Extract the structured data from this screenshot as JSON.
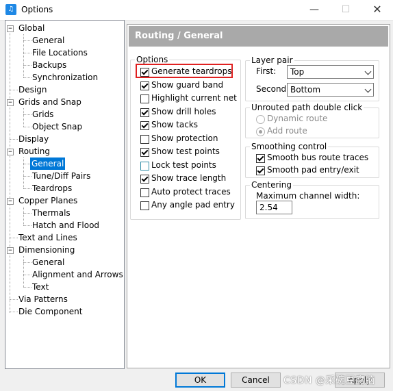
{
  "window": {
    "title": "Options",
    "app_icon_glyph": "♫",
    "minimize_glyph": "—",
    "maximize_glyph": "☐",
    "close_glyph": "✕"
  },
  "tree": {
    "expander_minus": "−",
    "global": "Global",
    "general": "General",
    "file_locations": "File Locations",
    "backups": "Backups",
    "synchronization": "Synchronization",
    "design": "Design",
    "grids_and_snap": "Grids and Snap",
    "grids": "Grids",
    "object_snap": "Object Snap",
    "display": "Display",
    "routing": "Routing",
    "routing_general": "General",
    "tune_diff_pairs": "Tune/Diff Pairs",
    "teardrops": "Teardrops",
    "copper_planes": "Copper Planes",
    "thermals": "Thermals",
    "hatch_and_flood": "Hatch and Flood",
    "text_and_lines": "Text and Lines",
    "dimensioning": "Dimensioning",
    "dim_general": "General",
    "alignment_and_arrows": "Alignment and Arrows",
    "text": "Text",
    "via_patterns": "Via Patterns",
    "die_component": "Die Component"
  },
  "panel": {
    "header": "Routing / General"
  },
  "options": {
    "title": "Options",
    "items": [
      {
        "label": "Generate teardrops",
        "checked": true
      },
      {
        "label": "Show guard band",
        "checked": true
      },
      {
        "label": "Highlight current net",
        "checked": false
      },
      {
        "label": "Show drill holes",
        "checked": true
      },
      {
        "label": "Show tacks",
        "checked": true
      },
      {
        "label": "Show protection",
        "checked": false
      },
      {
        "label": "Show test points",
        "checked": true
      },
      {
        "label": "Lock test points",
        "checked": false
      },
      {
        "label": "Show trace length",
        "checked": true
      },
      {
        "label": "Auto protect traces",
        "checked": false
      },
      {
        "label": "Any angle pad entry",
        "checked": false
      }
    ]
  },
  "layer_pair": {
    "title": "Layer pair",
    "first_label": "First:",
    "first_value": "Top",
    "second_label": "Second:",
    "second_value": "Bottom"
  },
  "unrouted": {
    "title": "Unrouted path double click",
    "opt1": "Dynamic route",
    "opt2": "Add route",
    "selected": "Add route"
  },
  "smoothing": {
    "title": "Smoothing control",
    "opt1": "Smooth bus route traces",
    "opt2": "Smooth pad entry/exit"
  },
  "centering": {
    "title": "Centering",
    "max_label": "Maximum channel width:",
    "max_value": "2.54"
  },
  "buttons": {
    "ok": "OK",
    "cancel": "Cancel",
    "apply": "Apply"
  },
  "watermark": "CSDN @采碗豆腐脑",
  "colors": {
    "selection": "#0078d7",
    "header_bg": "#a9a9a9",
    "highlight_box": "#e02020"
  }
}
